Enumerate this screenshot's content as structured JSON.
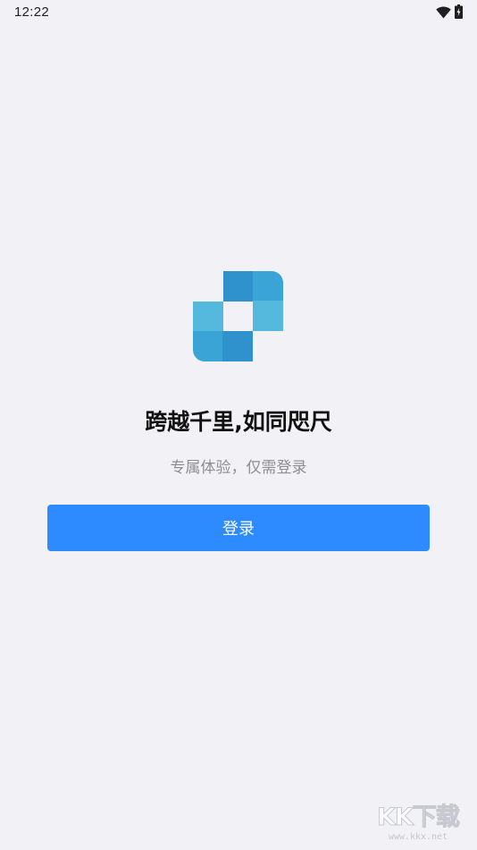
{
  "status_bar": {
    "time": "12:22",
    "icons": [
      "wifi-icon",
      "battery-charging-icon"
    ]
  },
  "logo": {
    "icon": "app-logo-icon",
    "colors": [
      "#2f92cc",
      "#3aa4d6",
      "#55b9dd"
    ]
  },
  "main": {
    "tagline": "跨越千里,如同咫尺",
    "subtitle": "专属体验，仅需登录",
    "login_button": "登录"
  },
  "watermark": {
    "mark": "KK下载",
    "url": "www.kkx.net"
  },
  "colors": {
    "background": "#f1f1f6",
    "accent": "#2e8bff",
    "subtitle": "#8d8d92"
  }
}
